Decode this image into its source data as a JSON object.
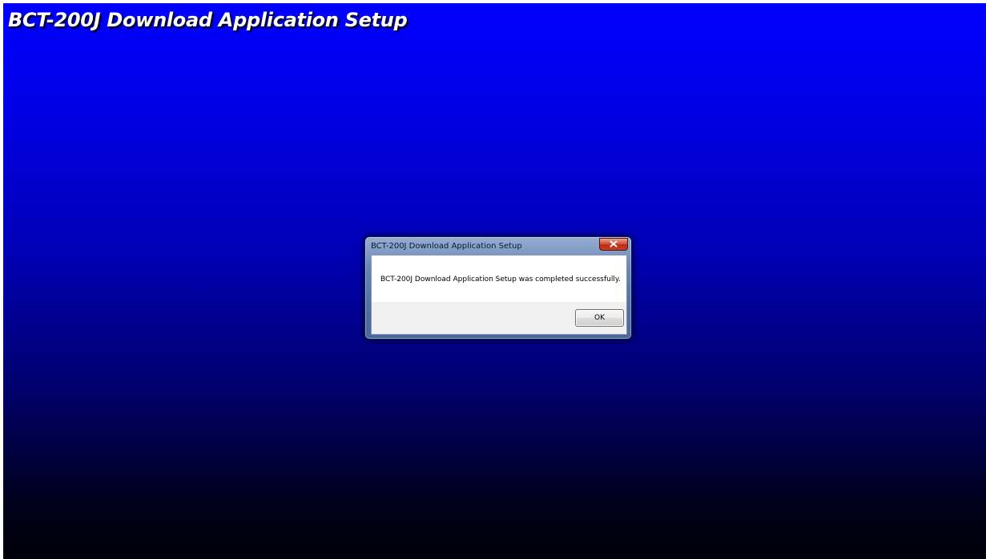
{
  "background": {
    "title": "BCT-200J Download Application Setup",
    "gradient_top": "#0000ff",
    "gradient_bottom": "#000008"
  },
  "dialog": {
    "title": "BCT-200J Download Application Setup",
    "message": "BCT-200J Download Application Setup was completed successfully.",
    "ok_label": "OK",
    "close_icon": "close-icon"
  }
}
